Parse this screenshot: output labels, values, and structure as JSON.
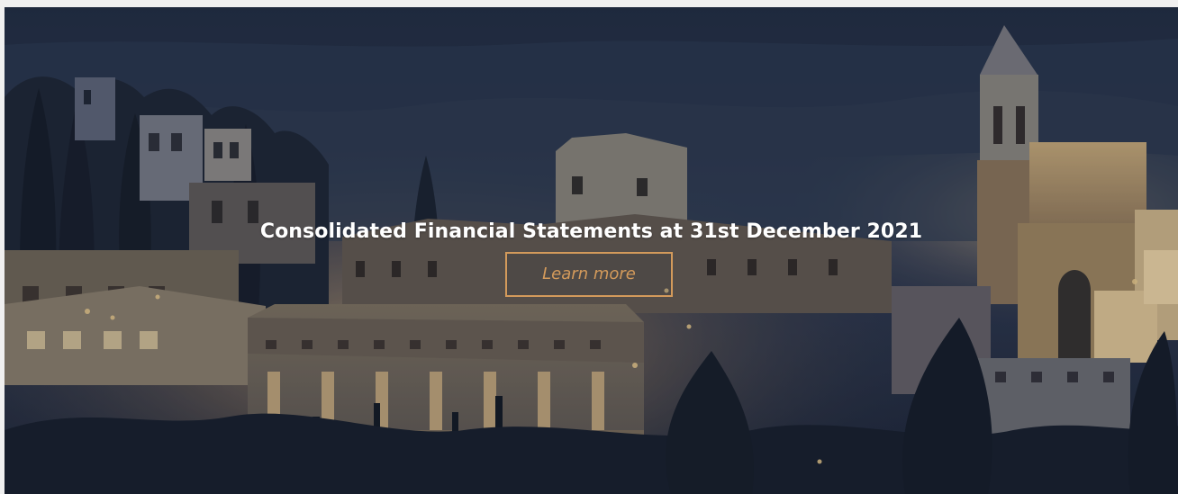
{
  "hero": {
    "title": "Consolidated Financial Statements at 31st December 2021",
    "cta_label": "Learn more"
  },
  "colors": {
    "page_background": "#f0f0f0",
    "cta_accent": "#d39a5b",
    "title_text": "#ffffff",
    "night_sky": "#26324a"
  }
}
